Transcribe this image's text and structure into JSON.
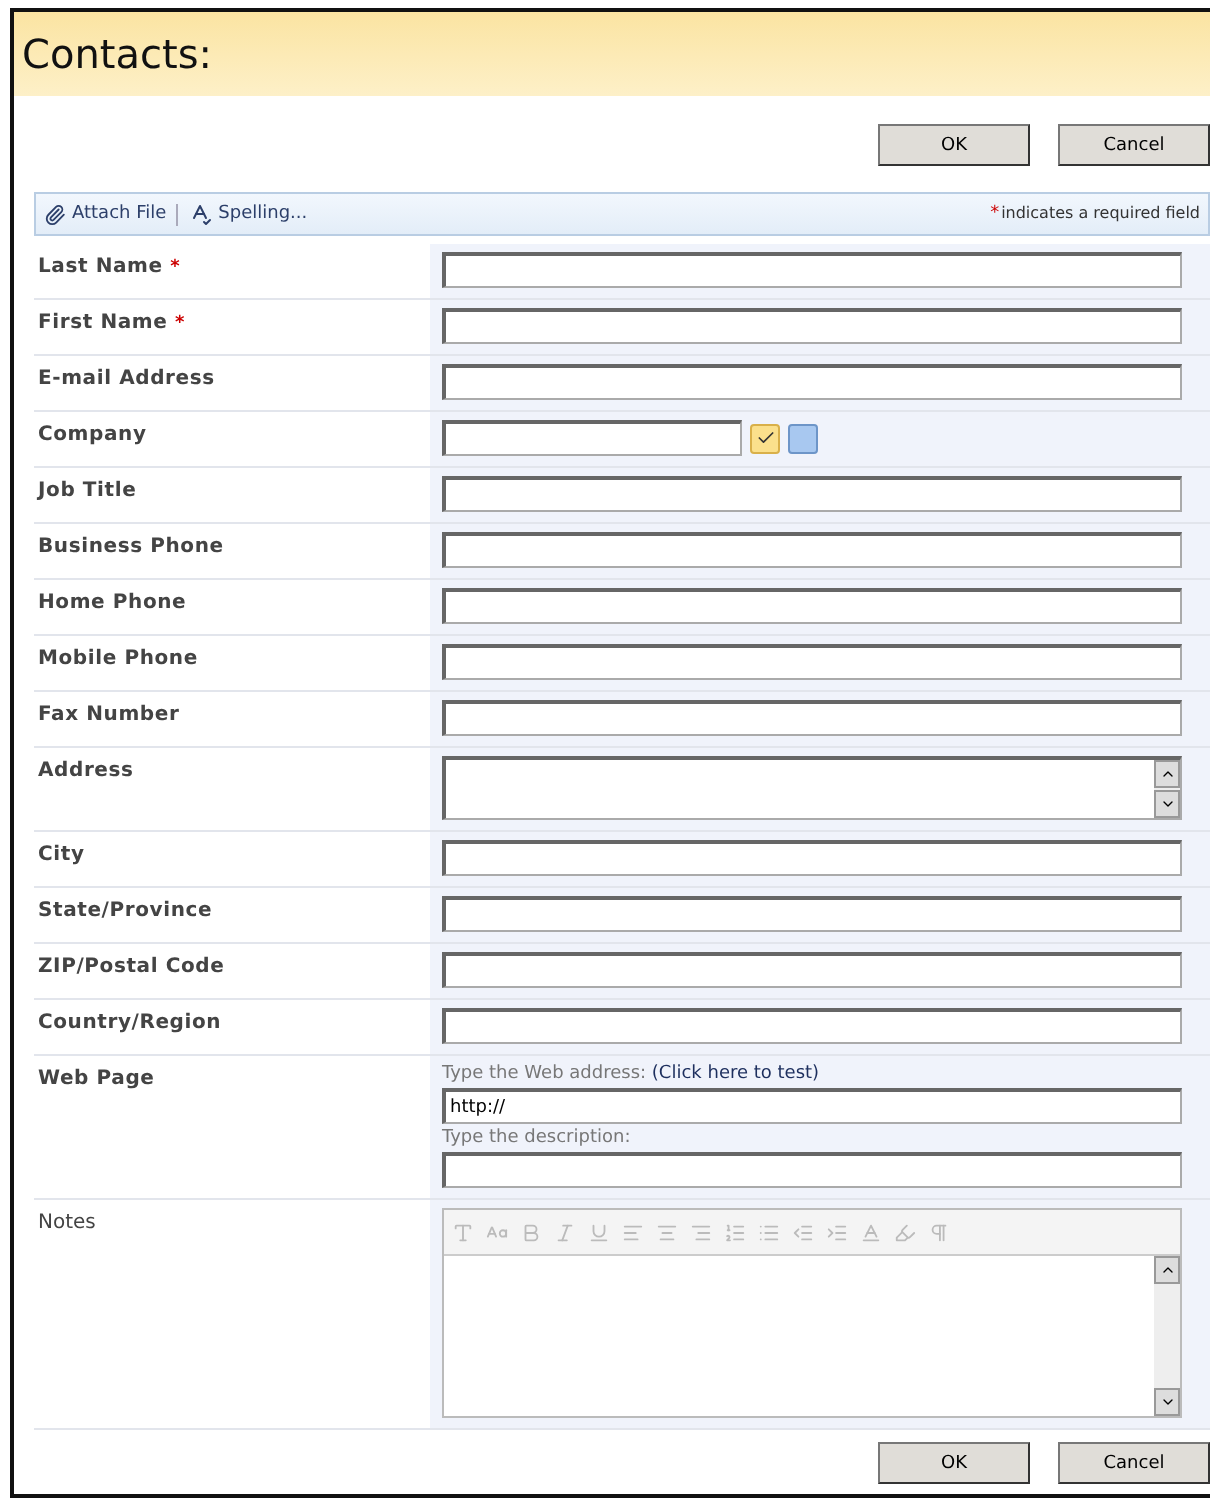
{
  "title": "Contacts:",
  "buttons": [
    "OK",
    "Cancel"
  ],
  "toolbar": {
    "items": [
      {
        "kind": "attach",
        "label": "Attach File"
      },
      {
        "kind": "spelling",
        "label": "Spelling..."
      }
    ],
    "required_mark": "*",
    "required_note": "indicates a required field"
  },
  "fields": [
    {
      "kind": "text",
      "label": "Last Name",
      "required": true
    },
    {
      "kind": "text",
      "label": "First Name",
      "required": true
    },
    {
      "kind": "text",
      "label": "E-mail Address",
      "required": false
    },
    {
      "kind": "company",
      "label": "Company",
      "required": false
    },
    {
      "kind": "text",
      "label": "Job Title",
      "required": false
    },
    {
      "kind": "text",
      "label": "Business Phone",
      "required": false
    },
    {
      "kind": "text",
      "label": "Home Phone",
      "required": false
    },
    {
      "kind": "text",
      "label": "Mobile Phone",
      "required": false
    },
    {
      "kind": "text",
      "label": "Fax Number",
      "required": false
    },
    {
      "kind": "textarea",
      "label": "Address",
      "required": false
    },
    {
      "kind": "text",
      "label": "City",
      "required": false
    },
    {
      "kind": "text",
      "label": "State/Province",
      "required": false
    },
    {
      "kind": "text",
      "label": "ZIP/Postal Code",
      "required": false
    },
    {
      "kind": "text",
      "label": "Country/Region",
      "required": false
    },
    {
      "kind": "web",
      "label": "Web Page",
      "required": false,
      "address_hint": "Type the Web address:",
      "test_link": "(Click here to test)",
      "value": "http://",
      "description_hint": "Type the description:"
    },
    {
      "kind": "notes",
      "label": "Notes",
      "required": false
    }
  ],
  "bottom_buttons": [
    "OK",
    "Cancel"
  ]
}
